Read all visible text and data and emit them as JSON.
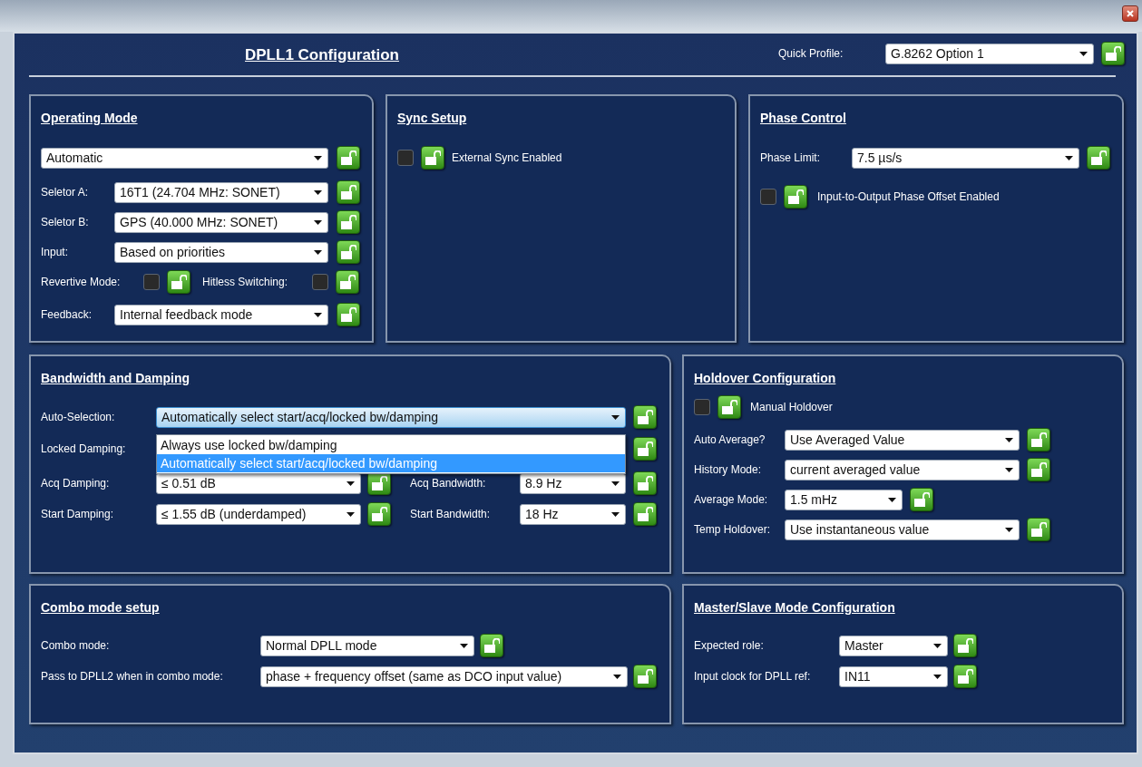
{
  "header": {
    "title": "DPLL1 Configuration",
    "quick_profile": {
      "label": "Quick Profile:",
      "value": "G.8262 Option 1",
      "locked": false
    }
  },
  "operating_mode": {
    "title": "Operating Mode",
    "mode": {
      "value": "Automatic",
      "locked": false
    },
    "fields": [
      {
        "label": "Seletor A:",
        "value": "16T1 (24.704 MHz: SONET)",
        "locked": false
      },
      {
        "label": "Seletor B:",
        "value": "GPS (40.000 MHz: SONET)",
        "locked": false
      },
      {
        "label": "Input:",
        "value": "Based on priorities",
        "locked": false
      }
    ],
    "toggles": [
      {
        "label": "Revertive Mode:",
        "checked": false,
        "locked": false
      },
      {
        "label": "Hitless Switching:",
        "checked": false,
        "locked": false
      }
    ],
    "feedback": {
      "label": "Feedback:",
      "value": "Internal feedback mode",
      "locked": false
    }
  },
  "sync_setup": {
    "title": "Sync Setup",
    "option": {
      "label": "External Sync Enabled",
      "checked": false,
      "locked": false
    }
  },
  "phase_control": {
    "title": "Phase Control",
    "phase_limit": {
      "label": "Phase Limit:",
      "value": "7.5 µs/s",
      "locked": false
    },
    "option": {
      "label": "Input-to-Output Phase Offset Enabled",
      "checked": false,
      "locked": false
    }
  },
  "bandwidth_damping": {
    "title": "Bandwidth and Damping",
    "auto_selection": {
      "label": "Auto-Selection:",
      "value": "Automatically select start/acq/locked bw/damping",
      "locked": false,
      "expanded": true,
      "options": [
        {
          "label": "Always use locked bw/damping",
          "selected": false
        },
        {
          "label": "Automatically select start/acq/locked bw/damping",
          "selected": true
        }
      ]
    },
    "locked_row": {
      "damping_label": "Locked Damping:",
      "bandwidth_lock": {
        "locked": false
      }
    },
    "rows": [
      {
        "damping": {
          "label": "Acq Damping:",
          "value": "≤ 0.51 dB",
          "locked": false
        },
        "bandwidth": {
          "label": "Acq Bandwidth:",
          "value": "8.9 Hz",
          "locked": false
        }
      },
      {
        "damping": {
          "label": "Start Damping:",
          "value": "≤ 1.55 dB (underdamped)",
          "locked": false
        },
        "bandwidth": {
          "label": "Start Bandwidth:",
          "value": "18 Hz",
          "locked": false
        }
      }
    ]
  },
  "holdover": {
    "title": "Holdover Configuration",
    "option": {
      "label": "Manual Holdover",
      "checked": false,
      "locked": false
    },
    "fields": [
      {
        "label": "Auto Average?",
        "value": "Use Averaged Value",
        "locked": false
      },
      {
        "label": "History Mode:",
        "value": "current averaged value",
        "locked": false
      },
      {
        "label": "Average Mode:",
        "value": "1.5 mHz",
        "locked": false
      },
      {
        "label": "Temp Holdover:",
        "value": "Use instantaneous value",
        "locked": false
      }
    ]
  },
  "combo_mode": {
    "title": "Combo mode setup",
    "fields": [
      {
        "label": "Combo mode:",
        "value": "Normal DPLL mode",
        "locked": false
      },
      {
        "label": "Pass to DPLL2 when in combo mode:",
        "value": "phase + frequency offset (same as DCO input value)",
        "locked": false
      }
    ]
  },
  "master_slave": {
    "title": "Master/Slave Mode Configuration",
    "fields": [
      {
        "label": "Expected role:",
        "value": "Master",
        "locked": false
      },
      {
        "label": "Input clock for DPLL ref:",
        "value": "IN11",
        "locked": false
      }
    ]
  }
}
